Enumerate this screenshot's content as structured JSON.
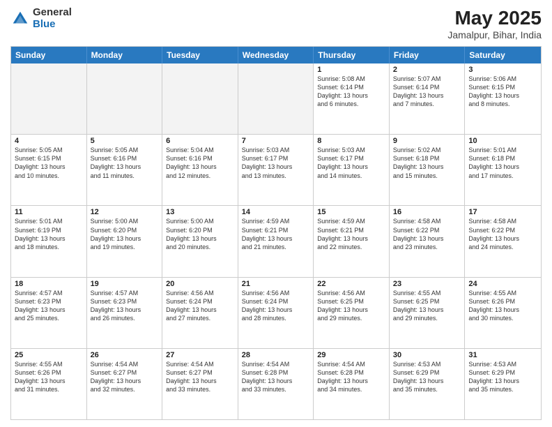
{
  "logo": {
    "general": "General",
    "blue": "Blue"
  },
  "title": "May 2025",
  "subtitle": "Jamalpur, Bihar, India",
  "weekdays": [
    "Sunday",
    "Monday",
    "Tuesday",
    "Wednesday",
    "Thursday",
    "Friday",
    "Saturday"
  ],
  "weeks": [
    [
      {
        "day": "",
        "info": "",
        "shade": true
      },
      {
        "day": "",
        "info": "",
        "shade": true
      },
      {
        "day": "",
        "info": "",
        "shade": true
      },
      {
        "day": "",
        "info": "",
        "shade": true
      },
      {
        "day": "1",
        "info": "Sunrise: 5:08 AM\nSunset: 6:14 PM\nDaylight: 13 hours\nand 6 minutes.",
        "shade": false
      },
      {
        "day": "2",
        "info": "Sunrise: 5:07 AM\nSunset: 6:14 PM\nDaylight: 13 hours\nand 7 minutes.",
        "shade": false
      },
      {
        "day": "3",
        "info": "Sunrise: 5:06 AM\nSunset: 6:15 PM\nDaylight: 13 hours\nand 8 minutes.",
        "shade": false
      }
    ],
    [
      {
        "day": "4",
        "info": "Sunrise: 5:05 AM\nSunset: 6:15 PM\nDaylight: 13 hours\nand 10 minutes.",
        "shade": false
      },
      {
        "day": "5",
        "info": "Sunrise: 5:05 AM\nSunset: 6:16 PM\nDaylight: 13 hours\nand 11 minutes.",
        "shade": false
      },
      {
        "day": "6",
        "info": "Sunrise: 5:04 AM\nSunset: 6:16 PM\nDaylight: 13 hours\nand 12 minutes.",
        "shade": false
      },
      {
        "day": "7",
        "info": "Sunrise: 5:03 AM\nSunset: 6:17 PM\nDaylight: 13 hours\nand 13 minutes.",
        "shade": false
      },
      {
        "day": "8",
        "info": "Sunrise: 5:03 AM\nSunset: 6:17 PM\nDaylight: 13 hours\nand 14 minutes.",
        "shade": false
      },
      {
        "day": "9",
        "info": "Sunrise: 5:02 AM\nSunset: 6:18 PM\nDaylight: 13 hours\nand 15 minutes.",
        "shade": false
      },
      {
        "day": "10",
        "info": "Sunrise: 5:01 AM\nSunset: 6:18 PM\nDaylight: 13 hours\nand 17 minutes.",
        "shade": false
      }
    ],
    [
      {
        "day": "11",
        "info": "Sunrise: 5:01 AM\nSunset: 6:19 PM\nDaylight: 13 hours\nand 18 minutes.",
        "shade": false
      },
      {
        "day": "12",
        "info": "Sunrise: 5:00 AM\nSunset: 6:20 PM\nDaylight: 13 hours\nand 19 minutes.",
        "shade": false
      },
      {
        "day": "13",
        "info": "Sunrise: 5:00 AM\nSunset: 6:20 PM\nDaylight: 13 hours\nand 20 minutes.",
        "shade": false
      },
      {
        "day": "14",
        "info": "Sunrise: 4:59 AM\nSunset: 6:21 PM\nDaylight: 13 hours\nand 21 minutes.",
        "shade": false
      },
      {
        "day": "15",
        "info": "Sunrise: 4:59 AM\nSunset: 6:21 PM\nDaylight: 13 hours\nand 22 minutes.",
        "shade": false
      },
      {
        "day": "16",
        "info": "Sunrise: 4:58 AM\nSunset: 6:22 PM\nDaylight: 13 hours\nand 23 minutes.",
        "shade": false
      },
      {
        "day": "17",
        "info": "Sunrise: 4:58 AM\nSunset: 6:22 PM\nDaylight: 13 hours\nand 24 minutes.",
        "shade": false
      }
    ],
    [
      {
        "day": "18",
        "info": "Sunrise: 4:57 AM\nSunset: 6:23 PM\nDaylight: 13 hours\nand 25 minutes.",
        "shade": false
      },
      {
        "day": "19",
        "info": "Sunrise: 4:57 AM\nSunset: 6:23 PM\nDaylight: 13 hours\nand 26 minutes.",
        "shade": false
      },
      {
        "day": "20",
        "info": "Sunrise: 4:56 AM\nSunset: 6:24 PM\nDaylight: 13 hours\nand 27 minutes.",
        "shade": false
      },
      {
        "day": "21",
        "info": "Sunrise: 4:56 AM\nSunset: 6:24 PM\nDaylight: 13 hours\nand 28 minutes.",
        "shade": false
      },
      {
        "day": "22",
        "info": "Sunrise: 4:56 AM\nSunset: 6:25 PM\nDaylight: 13 hours\nand 29 minutes.",
        "shade": false
      },
      {
        "day": "23",
        "info": "Sunrise: 4:55 AM\nSunset: 6:25 PM\nDaylight: 13 hours\nand 29 minutes.",
        "shade": false
      },
      {
        "day": "24",
        "info": "Sunrise: 4:55 AM\nSunset: 6:26 PM\nDaylight: 13 hours\nand 30 minutes.",
        "shade": false
      }
    ],
    [
      {
        "day": "25",
        "info": "Sunrise: 4:55 AM\nSunset: 6:26 PM\nDaylight: 13 hours\nand 31 minutes.",
        "shade": false
      },
      {
        "day": "26",
        "info": "Sunrise: 4:54 AM\nSunset: 6:27 PM\nDaylight: 13 hours\nand 32 minutes.",
        "shade": false
      },
      {
        "day": "27",
        "info": "Sunrise: 4:54 AM\nSunset: 6:27 PM\nDaylight: 13 hours\nand 33 minutes.",
        "shade": false
      },
      {
        "day": "28",
        "info": "Sunrise: 4:54 AM\nSunset: 6:28 PM\nDaylight: 13 hours\nand 33 minutes.",
        "shade": false
      },
      {
        "day": "29",
        "info": "Sunrise: 4:54 AM\nSunset: 6:28 PM\nDaylight: 13 hours\nand 34 minutes.",
        "shade": false
      },
      {
        "day": "30",
        "info": "Sunrise: 4:53 AM\nSunset: 6:29 PM\nDaylight: 13 hours\nand 35 minutes.",
        "shade": false
      },
      {
        "day": "31",
        "info": "Sunrise: 4:53 AM\nSunset: 6:29 PM\nDaylight: 13 hours\nand 35 minutes.",
        "shade": false
      }
    ]
  ]
}
